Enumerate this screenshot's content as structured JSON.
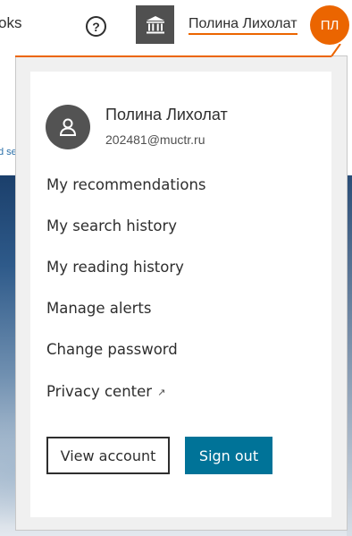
{
  "header": {
    "nav_fragment": "oks",
    "help_icon": "question-circle-icon",
    "institution_icon": "institution-building-icon",
    "user_name": "Полина Лихолат",
    "user_initials": "ПЛ"
  },
  "background": {
    "search_fragment": "d sear"
  },
  "profile": {
    "avatar_icon": "user-silhouette-icon",
    "name": "Полина Лихолат",
    "email": "202481@muctr.ru"
  },
  "menu": {
    "items": [
      {
        "label": "My recommendations"
      },
      {
        "label": "My search history"
      },
      {
        "label": "My reading history"
      },
      {
        "label": "Manage alerts"
      },
      {
        "label": "Change password"
      },
      {
        "label": "Privacy center",
        "icon": "external-link-icon"
      }
    ]
  },
  "actions": {
    "view_account": "View account",
    "sign_out": "Sign out"
  },
  "colors": {
    "accent_orange": "#eb6500",
    "signout_blue": "#007398",
    "institution_gray": "#505050"
  }
}
